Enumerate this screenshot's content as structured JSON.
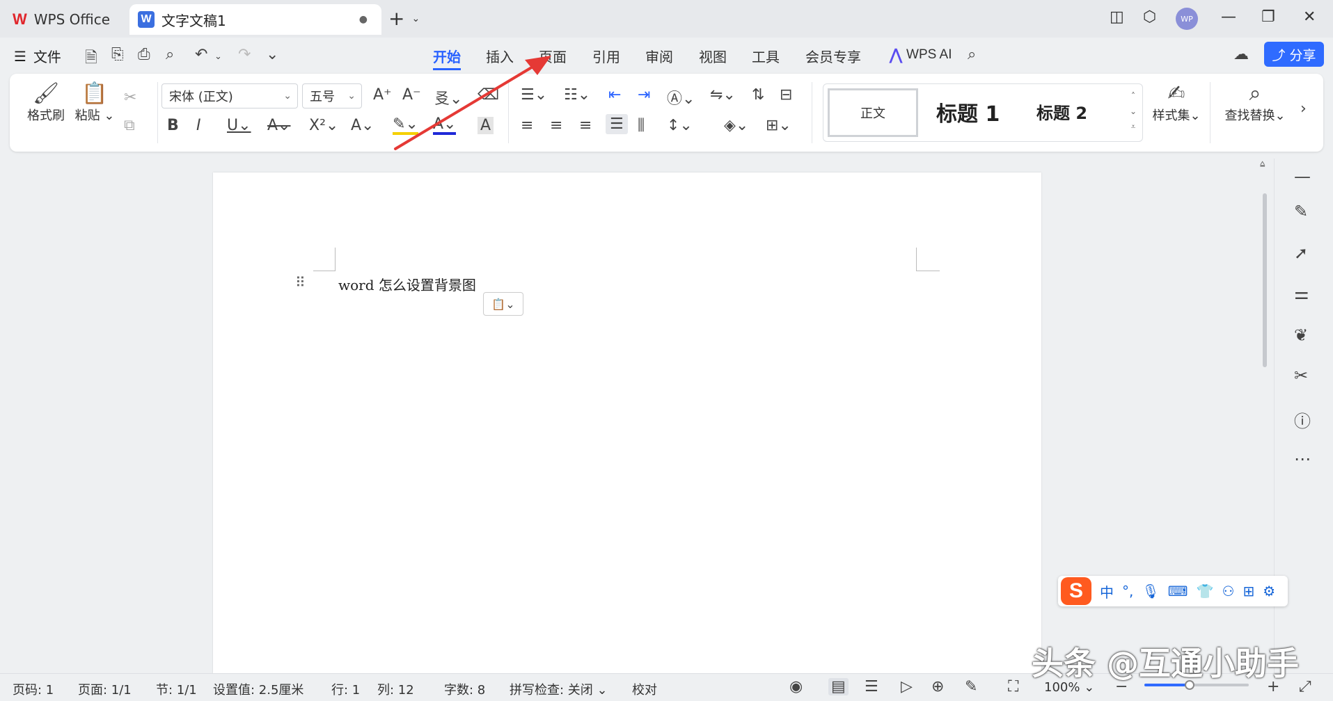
{
  "titlebar": {
    "app_name": "WPS Office",
    "app_logo": "W",
    "doc_badge": "W",
    "doc_tab_title": "文字文稿1",
    "doc_tab_dot": "●",
    "new_tab": "+",
    "avatar_text": "WP"
  },
  "menubar": {
    "file_label": "文件",
    "tabs": [
      "开始",
      "插入",
      "页面",
      "引用",
      "审阅",
      "视图",
      "工具",
      "会员专享"
    ],
    "active_tab": "开始",
    "ai_label": "WPS AI",
    "share_label": "分享"
  },
  "ribbon": {
    "format_painter": "格式刷",
    "paste": "粘贴",
    "font_name": "宋体 (正文)",
    "font_size": "五号",
    "styles": {
      "normal": "正文",
      "heading1": "标题 1",
      "heading2": "标题 2"
    },
    "style_set": "样式集",
    "find_replace": "查找替换",
    "colors": {
      "highlight": "#f5d000",
      "font_color": "#1f2ad8"
    }
  },
  "document": {
    "body_text": "word 怎么设置背景图"
  },
  "statusbar": {
    "page_num": "页码: 1",
    "pages": "页面: 1/1",
    "section": "节: 1/1",
    "setting": "设置值: 2.5厘米",
    "line": "行: 1",
    "column": "列: 12",
    "word_count": "字数: 8",
    "spell_check": "拼写检查: 关闭",
    "proofread": "校对",
    "zoom": "100%",
    "zoom_fraction": 0.43
  },
  "ime": {
    "logo": "S",
    "mode": "中",
    "punct": "°,"
  },
  "watermark": "头条 @互通小助手",
  "accent_color": "#2962ff",
  "annotation_color": "#e53935"
}
